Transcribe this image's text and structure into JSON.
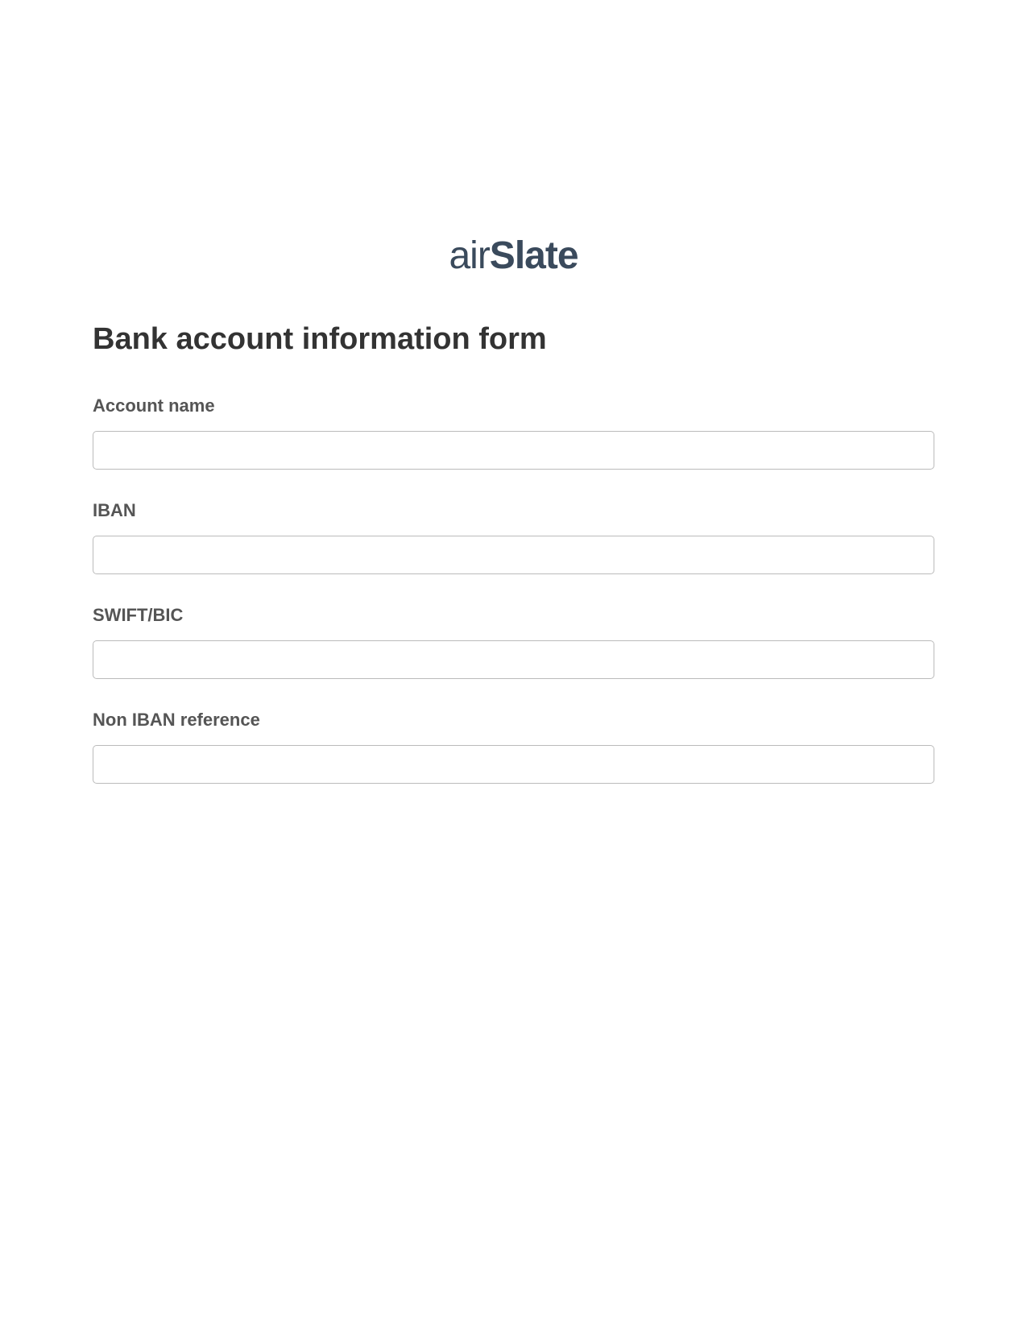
{
  "logo": {
    "text_air": "air",
    "text_slate": "Slate"
  },
  "form": {
    "title": "Bank account information form",
    "fields": [
      {
        "label": "Account name",
        "value": ""
      },
      {
        "label": "IBAN",
        "value": ""
      },
      {
        "label": "SWIFT/BIC",
        "value": ""
      },
      {
        "label": "Non IBAN reference",
        "value": ""
      }
    ]
  }
}
